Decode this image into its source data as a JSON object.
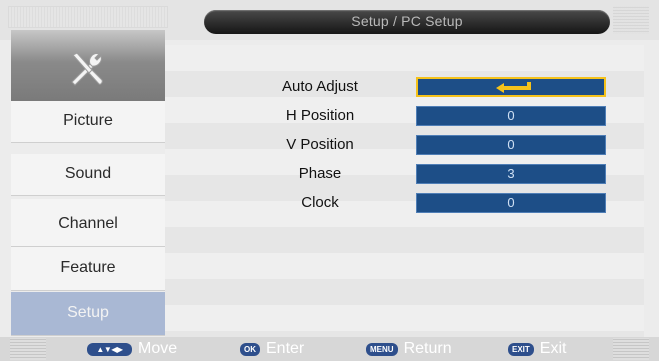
{
  "header": {
    "title": "Setup / PC Setup"
  },
  "sidebar": {
    "icon": "tools-icon",
    "items": [
      {
        "label": "Picture",
        "active": false
      },
      {
        "label": "Sound",
        "active": false
      },
      {
        "label": "Channel",
        "active": false
      },
      {
        "label": "Feature",
        "active": false
      },
      {
        "label": "Setup",
        "active": true
      }
    ]
  },
  "settings": [
    {
      "label": "Auto Adjust",
      "value": "",
      "icon": "enter-arrow-icon",
      "selected": true
    },
    {
      "label": "H Position",
      "value": "0"
    },
    {
      "label": "V Position",
      "value": "0"
    },
    {
      "label": "Phase",
      "value": "3"
    },
    {
      "label": "Clock",
      "value": "0"
    }
  ],
  "footer": {
    "hints": [
      {
        "key": "▲▼◀▶",
        "label": "Move"
      },
      {
        "key": "OK",
        "label": "Enter"
      },
      {
        "key": "MENU",
        "label": "Return"
      },
      {
        "key": "EXIT",
        "label": "Exit"
      }
    ]
  },
  "colors": {
    "value_box": "#1d4e87",
    "selection_border": "#f5c21a",
    "active_item": "#a9b8d4",
    "title_bar": "#1e1e1e"
  }
}
